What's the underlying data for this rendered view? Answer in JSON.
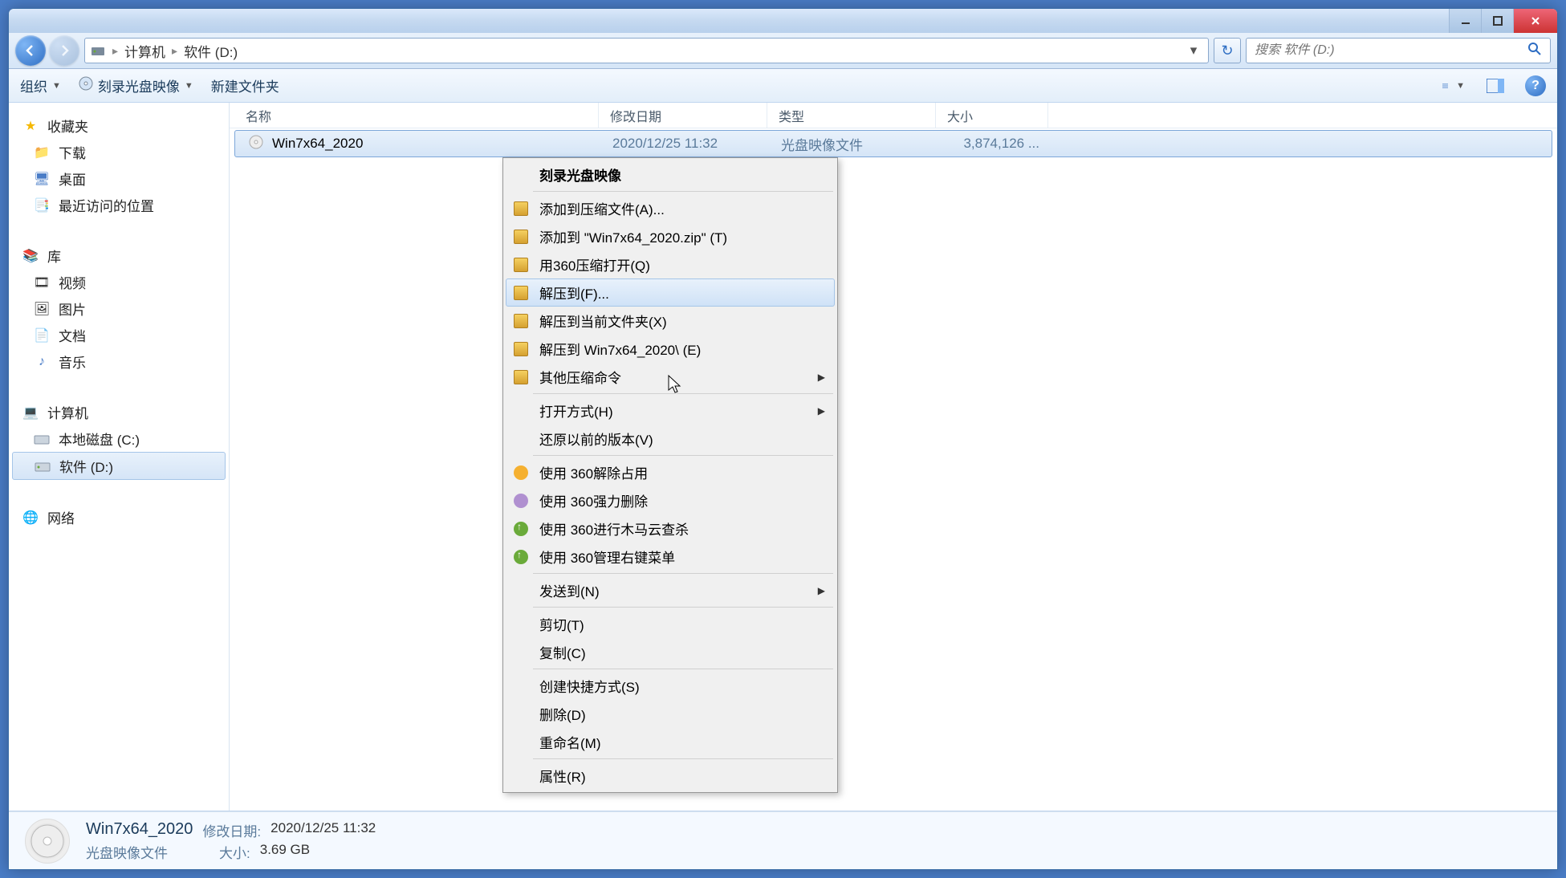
{
  "breadcrumb": {
    "segments": [
      "计算机",
      "软件 (D:)"
    ]
  },
  "search": {
    "placeholder": "搜索 软件 (D:)"
  },
  "toolbar": {
    "organize": "组织",
    "burn": "刻录光盘映像",
    "newfolder": "新建文件夹"
  },
  "sidebar": {
    "favorites": {
      "head": "收藏夹",
      "items": [
        "下载",
        "桌面",
        "最近访问的位置"
      ]
    },
    "libraries": {
      "head": "库",
      "items": [
        "视频",
        "图片",
        "文档",
        "音乐"
      ]
    },
    "computer": {
      "head": "计算机",
      "items": [
        "本地磁盘 (C:)",
        "软件 (D:)"
      ],
      "selected": 1
    },
    "network": {
      "head": "网络"
    }
  },
  "columns": {
    "name": "名称",
    "date": "修改日期",
    "type": "类型",
    "size": "大小"
  },
  "files": [
    {
      "name": "Win7x64_2020",
      "date": "2020/12/25 11:32",
      "type": "光盘映像文件",
      "size": "3,874,126 ..."
    }
  ],
  "context_menu": {
    "burn": "刻录光盘映像",
    "add_a": "添加到压缩文件(A)...",
    "add_t": "添加到 \"Win7x64_2020.zip\" (T)",
    "open_q": "用360压缩打开(Q)",
    "extract_f": "解压到(F)...",
    "extract_x": "解压到当前文件夹(X)",
    "extract_e": "解压到 Win7x64_2020\\ (E)",
    "other_zip": "其他压缩命令",
    "open_with": "打开方式(H)",
    "restore_v": "还原以前的版本(V)",
    "u360_occupy": "使用 360解除占用",
    "u360_delete": "使用 360强力删除",
    "u360_scan": "使用 360进行木马云查杀",
    "u360_menu": "使用 360管理右键菜单",
    "send_to": "发送到(N)",
    "cut": "剪切(T)",
    "copy": "复制(C)",
    "shortcut": "创建快捷方式(S)",
    "delete": "删除(D)",
    "rename": "重命名(M)",
    "props": "属性(R)"
  },
  "details": {
    "name": "Win7x64_2020",
    "type": "光盘映像文件",
    "date_lbl": "修改日期:",
    "date": "2020/12/25 11:32",
    "size_lbl": "大小:",
    "size": "3.69 GB"
  }
}
